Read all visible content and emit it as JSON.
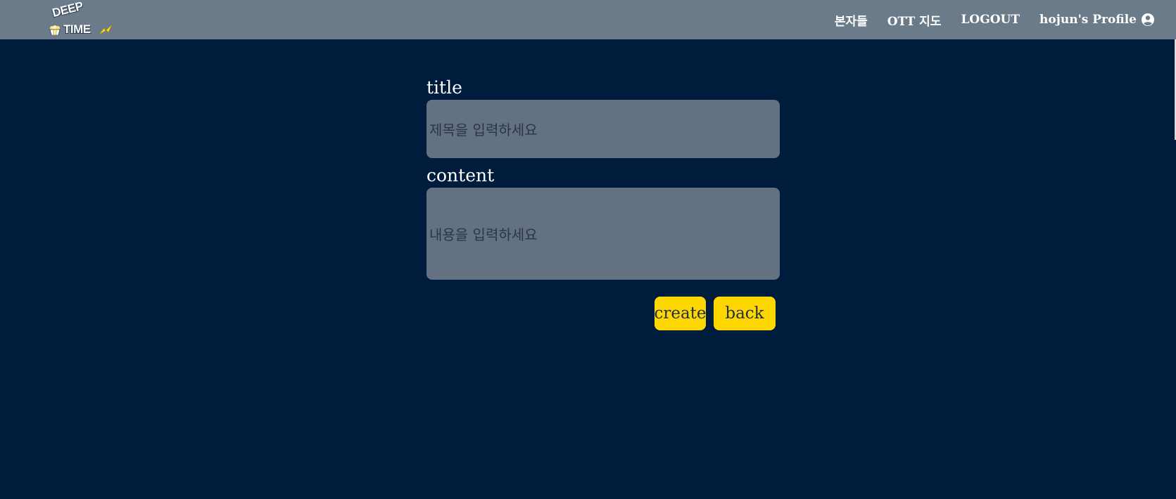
{
  "navbar": {
    "logo": {
      "line1": "DEEP",
      "line2": "TIME"
    },
    "links": [
      {
        "label": "본자들"
      },
      {
        "label": "OTT 지도"
      },
      {
        "label": "LOGOUT"
      },
      {
        "label": "hojun's Profile",
        "icon": "user-circle-icon"
      }
    ]
  },
  "form": {
    "title_label": "title",
    "title_placeholder": "제목을 입력하세요",
    "content_label": "content",
    "content_placeholder": "내용을 입력하세요",
    "create_label": "create",
    "back_label": "back"
  },
  "colors": {
    "navbar_bg": "#6c7b8a",
    "page_bg": "#001c3d",
    "field_bg": "#637183",
    "button_bg": "#ffd700"
  }
}
